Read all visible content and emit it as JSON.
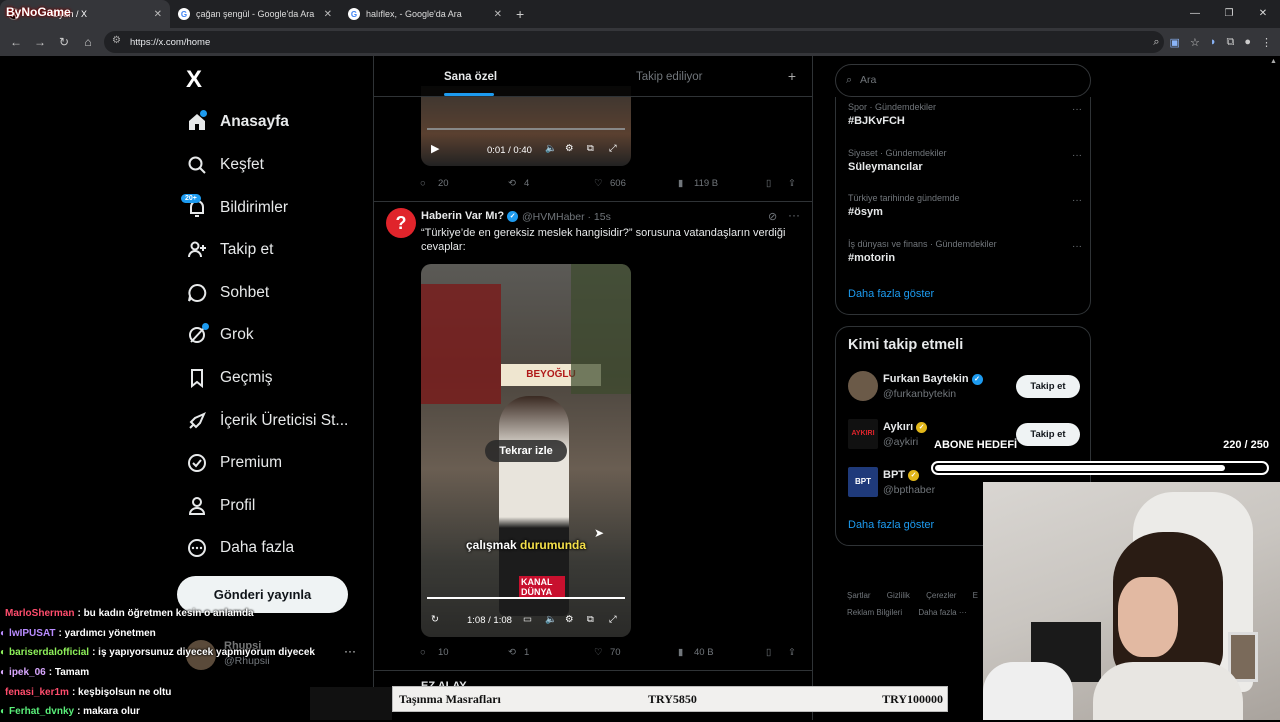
{
  "browser": {
    "tabs": [
      {
        "title": "Oyun / X",
        "favicon": "X",
        "active": true
      },
      {
        "title": "çağan şengül - Google'da Ara",
        "favicon": "G",
        "active": false
      },
      {
        "title": "halıflex, - Google'da Ara",
        "favicon": "G",
        "active": false
      }
    ],
    "stream_title_overlay": "ByNoGame",
    "url": "https://x.com/home"
  },
  "nav": {
    "logo": "X",
    "items": [
      {
        "label": "Anasayfa",
        "icon": "home-icon"
      },
      {
        "label": "Keşfet",
        "icon": "search-icon"
      },
      {
        "label": "Bildirimler",
        "icon": "bell-icon"
      },
      {
        "label": "Takip et",
        "icon": "follow-icon"
      },
      {
        "label": "Sohbet",
        "icon": "chat-icon"
      },
      {
        "label": "Grok",
        "icon": "grok-icon"
      },
      {
        "label": "Geçmiş",
        "icon": "bookmark-icon"
      },
      {
        "label": "İçerik Üreticisi St...",
        "icon": "rocket-icon"
      },
      {
        "label": "Premium",
        "icon": "premium-icon"
      },
      {
        "label": "Profil",
        "icon": "profile-icon"
      },
      {
        "label": "Daha fazla",
        "icon": "more-icon"
      }
    ],
    "notification_badge": "20+",
    "post_button": "Gönderi yayınla",
    "account": {
      "name": "Rhupsi",
      "handle": "@Rhupsii"
    }
  },
  "feed": {
    "tabs": [
      "Sana özel",
      "Takip ediliyor"
    ],
    "tweet1": {
      "video_time": "0:01 / 0:40",
      "replies": "20",
      "retweets": "4",
      "likes": "606",
      "views": "119 B"
    },
    "tweet2": {
      "name": "Haberin Var Mı?",
      "handle": "@HVMHaber · 15s",
      "text": "“Türkiye’de en gereksiz meslek hangisidir?” sorusuna vatandaşların verdiği cevaplar:",
      "replay_label": "Tekrar izle",
      "subtitle_white": "çalışmak",
      "subtitle_yellow": "durumunda",
      "video_time": "1:08 / 1:08",
      "replies": "10",
      "retweets": "1",
      "likes": "70",
      "views": "40 B",
      "video_watermark": "KANAL DÜNYA",
      "store_sign": "BEYOĞLU"
    },
    "tweet3_partial": {
      "name": "EZ ALAY"
    }
  },
  "sidebar": {
    "search_placeholder": "Ara",
    "trends": [
      {
        "category": "Spor · Gündemdekiler",
        "title": "#BJKvFCH"
      },
      {
        "category": "Siyaset · Gündemdekiler",
        "title": "Süleymancılar"
      },
      {
        "category": "Türkiye tarihinde gündemde",
        "title": "#ösym"
      },
      {
        "category": "İş dünyası ve finans · Gündemdekiler",
        "title": "#motorin"
      }
    ],
    "trends_more": "Daha fazla göster",
    "who_to_follow_title": "Kimi takip etmeli",
    "who_to_follow": [
      {
        "name": "Furkan Baytekin",
        "handle": "@furkanbytekin",
        "badge": "blue"
      },
      {
        "name": "Aykırı",
        "handle": "@aykiri",
        "badge": "gold"
      },
      {
        "name": "BPT",
        "handle": "@bpthaber",
        "badge": "gold"
      }
    ],
    "follow_label": "Takip et",
    "wtf_more": "Daha fazla göster",
    "footer_row1": [
      "Şartlar",
      "Gizlilik",
      "Çerezler",
      "E"
    ],
    "footer_row2": [
      "Reklam Bilgileri",
      "Daha fazla ···"
    ]
  },
  "stream": {
    "goal_title": "ABONE HEDEFİ",
    "goal_count": "220 / 250",
    "goal_fraction": 0.88,
    "chat": [
      {
        "user": "MarloSherman",
        "msg": "bu kadın öğretmen kesin o anlamda",
        "color": "#ff4d6d",
        "icon": false
      },
      {
        "user": "lwIPUSAT",
        "msg": "yardımcı yönetmen",
        "color": "#b98cff",
        "icon": true
      },
      {
        "user": "bariserdalofficial",
        "msg": "iş yapıyorsunuz diyecek yapmıyorum diyecek",
        "color": "#8ef05a",
        "icon": true
      },
      {
        "user": "ipek_06",
        "msg": "Tamam",
        "color": "#d9a7ff",
        "icon": true
      },
      {
        "user": "fenasi_ker1m",
        "msg": "keşbişolsun ne oltu",
        "color": "#ff4d6d",
        "icon": false
      },
      {
        "user": "Ferhat_dvnky",
        "msg": "makara olur",
        "color": "#5af07a",
        "icon": true
      }
    ],
    "cost_label": "Taşınma Masrafları",
    "cost_value1": "TRY5850",
    "cost_value2": "TRY100000"
  },
  "colors": {
    "accent": "#1d9bf0",
    "background": "#000000",
    "muted": "#71767b",
    "text": "#e7e9ea"
  }
}
